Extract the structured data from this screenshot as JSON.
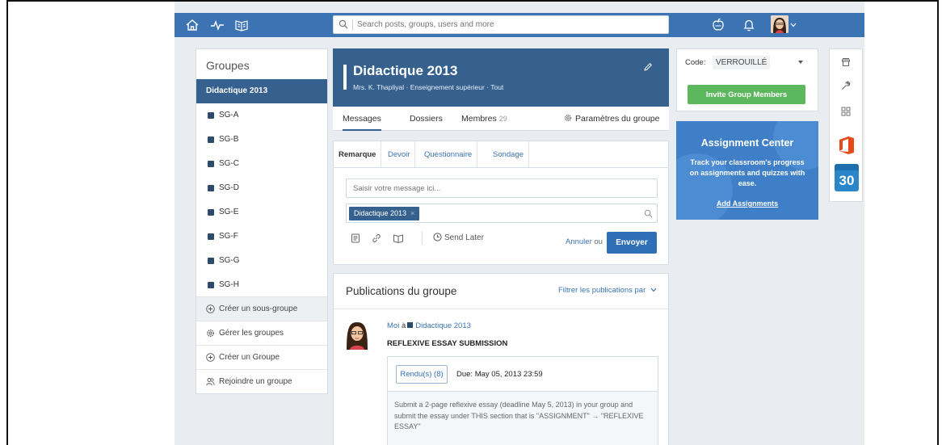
{
  "topbar": {
    "search_placeholder": "Search posts, groups, users and more"
  },
  "groups": {
    "title": "Groupes",
    "active": "Didactique 2013",
    "subgroups": [
      "SG-A",
      "SG-B",
      "SG-C",
      "SG-D",
      "SG-E",
      "SG-F",
      "SG-G",
      "SG-H"
    ],
    "actions": {
      "create_subgroup": "Créer un sous-groupe",
      "manage": "Gérer les groupes",
      "create_group": "Créer un Groupe",
      "join_group": "Rejoindre un groupe"
    }
  },
  "group_header": {
    "title": "Didactique 2013",
    "subtitle": "Mrs. K. Thapliyal · Enseignement supérieur · Tout",
    "tabs": {
      "messages": "Messages",
      "folders": "Dossiers",
      "members": "Membres",
      "members_count": "29",
      "settings": "Paramètres du groupe"
    }
  },
  "composer": {
    "tabs": [
      "Remarque",
      "Devoir",
      "Questionnaire",
      "Sondage"
    ],
    "message_placeholder": "Saisir votre message ici...",
    "recipient_chip": "Didactique 2013",
    "chip_close": "×",
    "send_later": "Send Later",
    "cancel": "Annuler",
    "cancel_or": "ou",
    "send": "Envoyer"
  },
  "posts": {
    "title": "Publications du groupe",
    "filter": "Filtrer les publications par",
    "items": [
      {
        "author": "Moi",
        "to_word": "à",
        "group": "Didactique 2013",
        "title": "REFLEXIVE ESSAY SUBMISSION",
        "turned_in": "Rendu(s) (8)",
        "due": "Due: May 05, 2013 23:59",
        "description": "Submit a 2-page reflexive essay (deadline May 5, 2013) in your group and submit the essay under THIS section that is \"ASSIGNMENT\" → \"REFLEXIVE ESSAY\""
      }
    ]
  },
  "code_panel": {
    "label": "Code:",
    "value": "VERROUILLÉ",
    "invite": "Invite Group Members"
  },
  "assignment_center": {
    "title": "Assignment Center",
    "description": "Track your classroom's progress on assignments and quizzes with ease.",
    "link": "Add Assignments"
  },
  "apps": {
    "calendar_day": "30"
  },
  "colors": {
    "topbar": "#3b73b3",
    "group_header": "#36618f",
    "invite_button": "#5cb85c",
    "send_button": "#2f6fb8"
  },
  "icons": [
    "home-icon",
    "activity-icon",
    "book-icon",
    "search-icon",
    "apple-icon",
    "bell-icon",
    "store-icon",
    "wrench-icon",
    "apps-grid-icon",
    "office-icon",
    "calendar-icon"
  ]
}
